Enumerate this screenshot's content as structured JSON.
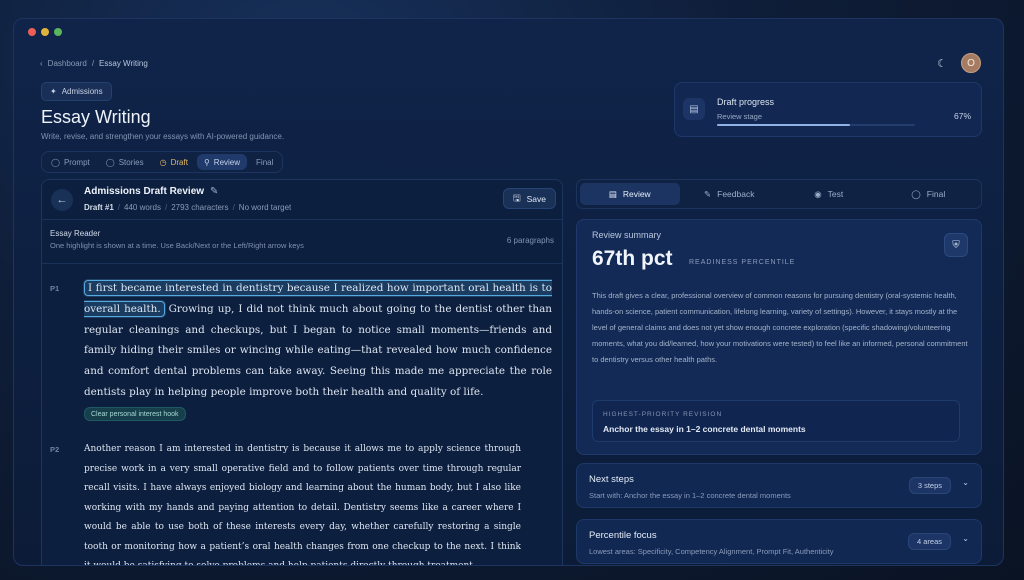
{
  "breadcrumb": {
    "parent": "Dashboard",
    "current": "Essay Writing"
  },
  "user": {
    "avatar_initial": "O"
  },
  "header": {
    "tag": "Admissions",
    "title": "Essay Writing",
    "subtitle": "Write, revise, and strengthen your essays with AI-powered guidance."
  },
  "stages": [
    {
      "label": "Prompt",
      "icon": "check-circle-icon"
    },
    {
      "label": "Stories",
      "icon": "check-circle-icon"
    },
    {
      "label": "Draft",
      "icon": "clock-icon"
    },
    {
      "label": "Review",
      "icon": "search-icon",
      "active": true
    },
    {
      "label": "Final"
    }
  ],
  "progress": {
    "label": "Draft progress",
    "stage": "Review stage",
    "percent_text": "67%",
    "value": 0.67
  },
  "draft": {
    "title": "Admissions Draft Review",
    "number": "Draft #1",
    "words": "440 words",
    "characters": "2793 characters",
    "target": "No word target",
    "save_label": "Save"
  },
  "reader": {
    "title": "Essay Reader",
    "hint": "One highlight is shown at a time. Use Back/Next or the Left/Right arrow keys",
    "count": "6 paragraphs"
  },
  "paragraphs": [
    {
      "label": "P1",
      "highlight": "I first became interested in dentistry because I realized how important oral health is to overall health.",
      "text": " Growing up, I did not think much about going to the dentist other than regular cleanings and checkups, but I began to notice small moments—friends and family hiding their smiles or wincing while eating—that revealed how much confidence and comfort dental problems can take away. Seeing this made me appreciate the role dentists play in helping people improve both their health and quality of life.",
      "tag": "Clear personal interest hook"
    },
    {
      "label": "P2",
      "text": "Another reason I am interested in dentistry is because it allows me to apply science through precise work in a very small operative field and to follow patients over time through regular recall visits. I have always enjoyed biology and learning about the human body, but I also like working with my hands and paying attention to detail. Dentistry seems like a career where I would be able to use both of these interests every day, whether carefully restoring a single tooth or monitoring how a patient’s oral health changes from one checkup to the next. I think it would be satisfying to solve problems and help patients directly through treatment."
    }
  ],
  "right_tabs": [
    {
      "label": "Review",
      "icon": "document-icon",
      "active": true
    },
    {
      "label": "Feedback",
      "icon": "pen-icon"
    },
    {
      "label": "Test",
      "icon": "eye-icon"
    },
    {
      "label": "Final",
      "icon": "check-circle-icon"
    }
  ],
  "summary": {
    "label": "Review summary",
    "score": "67th pct",
    "score_caption": "READINESS PERCENTILE",
    "body": "This draft gives a clear, professional overview of common reasons for pursuing dentistry (oral-systemic health, hands-on science, patient communication, lifelong learning, variety of settings). However, it stays mostly at the level of general claims and does not yet show enough concrete exploration (specific shadowing/volunteering moments, what you did/learned, how your motivations were tested) to feel like an informed, personal commitment to dentistry versus other health paths.",
    "priority_caption": "HIGHEST-PRIORITY REVISION",
    "priority_text": "Anchor the essay in 1–2 concrete dental moments"
  },
  "next_steps": {
    "title": "Next steps",
    "subtitle": "Start with: Anchor the essay in 1–2 concrete dental moments",
    "badge": "3 steps"
  },
  "percentile_focus": {
    "title": "Percentile focus",
    "subtitle": "Lowest areas: Specificity, Competency Alignment, Prompt Fit, Authenticity",
    "badge": "4 areas"
  },
  "colors": {
    "accent": "#8fb2e6",
    "highlight_border": "#56a9df",
    "draft_stage": "#e3b766",
    "tag_bg": "#163f4b"
  }
}
